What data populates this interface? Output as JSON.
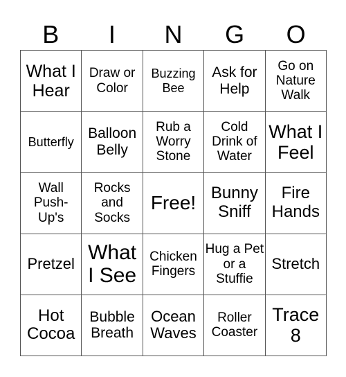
{
  "header": {
    "letters": [
      "B",
      "I",
      "N",
      "G",
      "O"
    ]
  },
  "cells": [
    [
      "What I Hear",
      "Draw or Color",
      "Buzzing Bee",
      "Ask for Help",
      "Go on Nature Walk"
    ],
    [
      "Butterfly",
      "Balloon Belly",
      "Rub a Worry Stone",
      "Cold Drink of Water",
      "What I Feel"
    ],
    [
      "Wall Push-Up's",
      "Rocks and Socks",
      "Free!",
      "Bunny Sniff",
      "Fire Hands"
    ],
    [
      "Pretzel",
      "What I See",
      "Chicken Fingers",
      "Hug a Pet or a Stuffie",
      "Stretch"
    ],
    [
      "Hot Cocoa",
      "Bubble Breath",
      "Ocean Waves",
      "Roller Coaster",
      "Trace 8"
    ]
  ]
}
